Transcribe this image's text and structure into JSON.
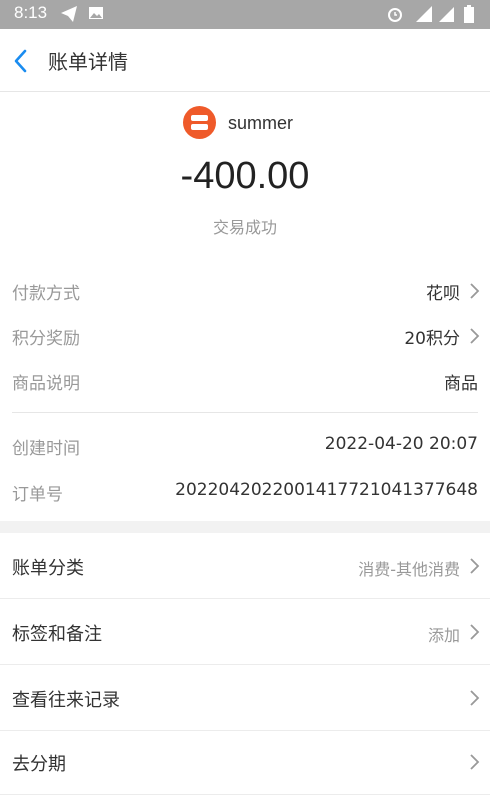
{
  "status_bar": {
    "time": "8:13",
    "icons": [
      "telegram-icon",
      "image-icon",
      "alarm-icon",
      "signal-4g-icon",
      "signal-icon",
      "battery-icon"
    ]
  },
  "header": {
    "title": "账单详情",
    "back_icon": "chevron-left-icon"
  },
  "merchant": {
    "name": "summer",
    "logo_color": "#ef5a2a"
  },
  "transaction": {
    "amount": "-400.00",
    "status": "交易成功"
  },
  "details": [
    {
      "label": "付款方式",
      "value": "花呗"
    },
    {
      "label": "积分奖励",
      "value": "20积分"
    },
    {
      "label": "商品说明",
      "value": "商品"
    },
    {
      "label": "创建时间",
      "value": "2022-04-20 20:07"
    },
    {
      "label": "订单号",
      "value": "2022042022001417721041377648"
    }
  ],
  "menu": [
    {
      "label": "账单分类",
      "value": "消费-其他消费"
    },
    {
      "label": "标签和备注",
      "value": "添加"
    },
    {
      "label": "查看往来记录",
      "value": ""
    },
    {
      "label": "去分期",
      "value": ""
    }
  ],
  "colors": {
    "accent": "#1a8cf0",
    "status_bar": "#a7a7a7"
  }
}
